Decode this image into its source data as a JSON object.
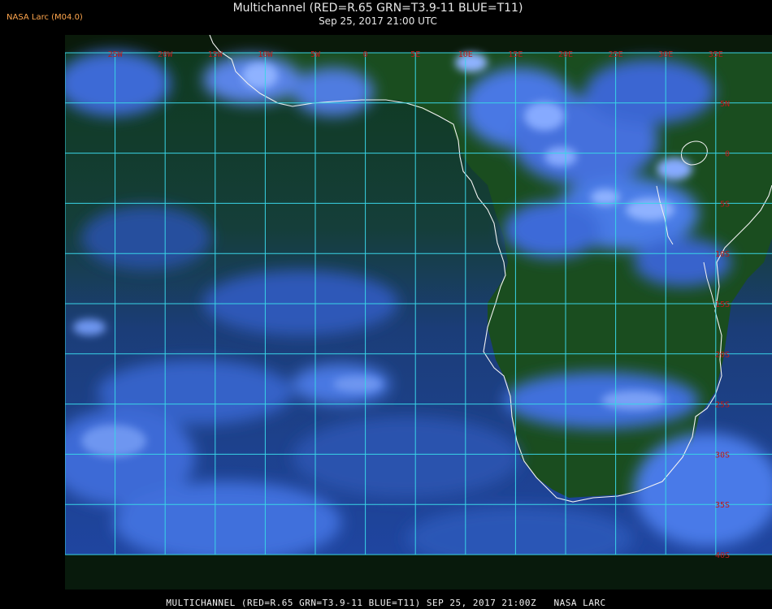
{
  "credit": "NASA Larc (M04.0)",
  "title": {
    "line1": "Multichannel (RED=R.65 GRN=T3.9-11 BLUE=T11)",
    "line2": "Sep 25, 2017 21:00 UTC"
  },
  "footer": "MULTICHANNEL (RED=R.65 GRN=T3.9-11 BLUE=T11) SEP 25, 2017 21:00Z   NASA LARC",
  "map": {
    "lon_labels": [
      "25W",
      "20W",
      "15W",
      "10W",
      "5W",
      "0",
      "5E",
      "10E",
      "15E",
      "20E",
      "25E",
      "30E",
      "35E"
    ],
    "lat_labels": [
      "5N",
      "0",
      "5S",
      "10S",
      "15S",
      "20S",
      "25S",
      "30S",
      "35S",
      "40S"
    ],
    "colors": {
      "grid": "#39d4e6",
      "label": "#c01818",
      "coast": "#f2f2f2",
      "ocean": "#1c3f8c",
      "land": "#164a1c",
      "cloud": "#3b6fe0",
      "cloud_bright": "#7aa8ff"
    }
  }
}
